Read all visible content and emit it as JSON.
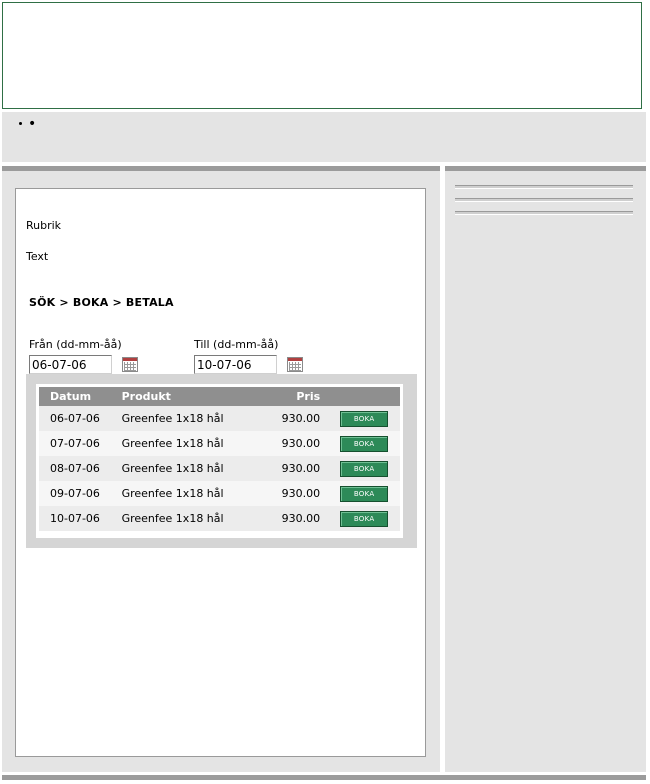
{
  "nav": {
    "bullet_text": ""
  },
  "main": {
    "heading": "Rubrik",
    "body_text": "Text",
    "breadcrumb": "SÖK > BOKA > BETALA"
  },
  "search": {
    "from_label": "Från (dd-mm-åå)",
    "from_value": "06-07-06",
    "to_label": "Till (dd-mm-åå)",
    "to_value": "10-07-06"
  },
  "table": {
    "headers": [
      "Datum",
      "Produkt",
      "Pris",
      ""
    ],
    "rows": [
      {
        "date": "06-07-06",
        "product": "Greenfee 1x18 hål",
        "price": "930.00",
        "action": "BOKA"
      },
      {
        "date": "07-07-06",
        "product": "Greenfee 1x18 hål",
        "price": "930.00",
        "action": "BOKA"
      },
      {
        "date": "08-07-06",
        "product": "Greenfee 1x18 hål",
        "price": "930.00",
        "action": "BOKA"
      },
      {
        "date": "09-07-06",
        "product": "Greenfee 1x18 hål",
        "price": "930.00",
        "action": "BOKA"
      },
      {
        "date": "10-07-06",
        "product": "Greenfee 1x18 hål",
        "price": "930.00",
        "action": "BOKA"
      }
    ]
  },
  "colors": {
    "header_border": "#2f6f45",
    "button_green": "#2d8a58",
    "table_header": "#8f8f8f",
    "bar_gray": "#9b9b9b",
    "panel_gray": "#e4e4e4"
  },
  "icons": [
    "calendar-icon",
    "calendar-icon"
  ]
}
